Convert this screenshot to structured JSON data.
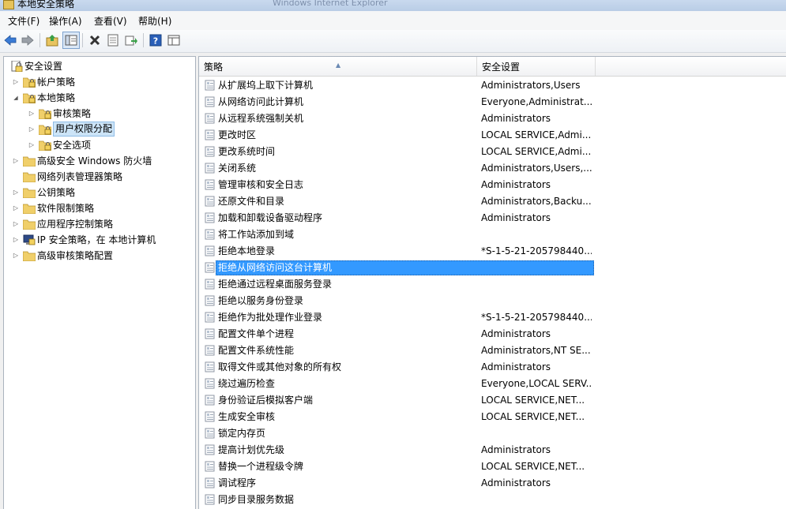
{
  "window": {
    "title": "本地安全策略",
    "ghost_text": "Windows Internet Explorer"
  },
  "menu": [
    {
      "label": "文件(F)"
    },
    {
      "label": "操作(A)"
    },
    {
      "label": "查看(V)"
    },
    {
      "label": "帮助(H)"
    }
  ],
  "toolbar": [
    {
      "name": "back-icon"
    },
    {
      "name": "forward-icon"
    },
    {
      "name": "up-folder-icon"
    },
    {
      "name": "show-hide-tree-icon"
    },
    {
      "name": "delete-icon"
    },
    {
      "name": "properties-icon"
    },
    {
      "name": "export-list-icon"
    },
    {
      "name": "help-icon"
    },
    {
      "name": "console-view-icon"
    }
  ],
  "tree": [
    {
      "label": "安全设置",
      "arrow": "",
      "icon": "security-settings-icon"
    },
    {
      "label": "帐户策略",
      "arrow": "▷",
      "icon": "folder-lock-icon"
    },
    {
      "label": "本地策略",
      "arrow": "◢",
      "icon": "folder-lock-icon"
    },
    {
      "label": "审核策略",
      "arrow": "▷",
      "icon": "folder-lock-icon"
    },
    {
      "label": "用户权限分配",
      "arrow": "▷",
      "icon": "folder-lock-icon"
    },
    {
      "label": "安全选项",
      "arrow": "▷",
      "icon": "folder-lock-icon"
    },
    {
      "label": "高级安全 Windows 防火墙",
      "arrow": "▷",
      "icon": "folder-icon"
    },
    {
      "label": "网络列表管理器策略",
      "arrow": "",
      "icon": "folder-icon"
    },
    {
      "label": "公钥策略",
      "arrow": "▷",
      "icon": "folder-icon"
    },
    {
      "label": "软件限制策略",
      "arrow": "▷",
      "icon": "folder-icon"
    },
    {
      "label": "应用程序控制策略",
      "arrow": "▷",
      "icon": "folder-icon"
    },
    {
      "label": "IP 安全策略，在 本地计算机",
      "arrow": "▷",
      "icon": "ipsec-icon"
    },
    {
      "label": "高级审核策略配置",
      "arrow": "▷",
      "icon": "folder-icon"
    }
  ],
  "list": {
    "columns": [
      "策略",
      "安全设置"
    ],
    "rows": [
      {
        "policy": "从扩展坞上取下计算机",
        "setting": "Administrators,Users"
      },
      {
        "policy": "从网络访问此计算机",
        "setting": "Everyone,Administrat..."
      },
      {
        "policy": "从远程系统强制关机",
        "setting": "Administrators"
      },
      {
        "policy": "更改时区",
        "setting": "LOCAL SERVICE,Admi..."
      },
      {
        "policy": "更改系统时间",
        "setting": "LOCAL SERVICE,Admi..."
      },
      {
        "policy": "关闭系统",
        "setting": "Administrators,Users,..."
      },
      {
        "policy": "管理审核和安全日志",
        "setting": "Administrators"
      },
      {
        "policy": "还原文件和目录",
        "setting": "Administrators,Backu..."
      },
      {
        "policy": "加载和卸载设备驱动程序",
        "setting": "Administrators"
      },
      {
        "policy": "将工作站添加到域",
        "setting": ""
      },
      {
        "policy": "拒绝本地登录",
        "setting": "*S-1-5-21-205798440..."
      },
      {
        "policy": "拒绝从网络访问这台计算机",
        "setting": ""
      },
      {
        "policy": "拒绝通过远程桌面服务登录",
        "setting": ""
      },
      {
        "policy": "拒绝以服务身份登录",
        "setting": ""
      },
      {
        "policy": "拒绝作为批处理作业登录",
        "setting": "*S-1-5-21-205798440..."
      },
      {
        "policy": "配置文件单个进程",
        "setting": "Administrators"
      },
      {
        "policy": "配置文件系统性能",
        "setting": "Administrators,NT SE..."
      },
      {
        "policy": "取得文件或其他对象的所有权",
        "setting": "Administrators"
      },
      {
        "policy": "绕过遍历检查",
        "setting": "Everyone,LOCAL SERV..."
      },
      {
        "policy": "身份验证后模拟客户端",
        "setting": "LOCAL SERVICE,NET..."
      },
      {
        "policy": "生成安全审核",
        "setting": "LOCAL SERVICE,NET..."
      },
      {
        "policy": "锁定内存页",
        "setting": ""
      },
      {
        "policy": "提高计划优先级",
        "setting": "Administrators"
      },
      {
        "policy": "替换一个进程级令牌",
        "setting": "LOCAL SERVICE,NET..."
      },
      {
        "policy": "调试程序",
        "setting": "Administrators"
      },
      {
        "policy": "同步目录服务数据",
        "setting": ""
      }
    ]
  },
  "colors": {
    "selection": "#3399ff",
    "tree_selection": "#cce4f7"
  }
}
